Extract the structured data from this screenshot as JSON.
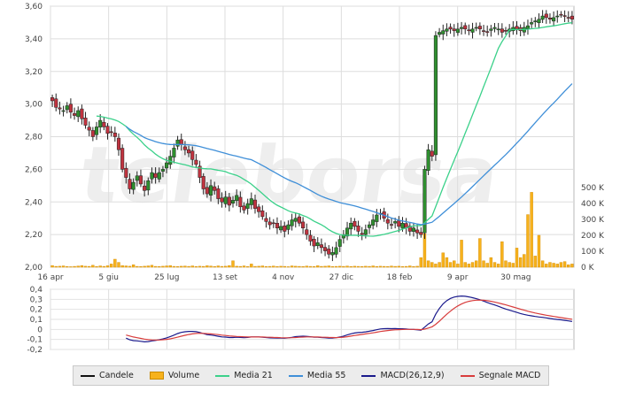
{
  "chart_data": {
    "type": "candlestick",
    "watermark": "teleborsa",
    "price_axis": {
      "ticks": [
        "3,60",
        "3,40",
        "3,20",
        "3,00",
        "2,80",
        "2,60",
        "2,40",
        "2,20",
        "2,00"
      ],
      "ylim": [
        2.0,
        3.6
      ]
    },
    "volume_axis": {
      "ticks": [
        "500 K",
        "400 K",
        "300 K",
        "200 K",
        "100 K",
        "0 K"
      ],
      "ylim": [
        0,
        500000
      ]
    },
    "macd_axis": {
      "ticks": [
        "0,4",
        "0,3",
        "0,2",
        "0,1",
        "0",
        "-0,1",
        "-0,2"
      ],
      "ylim": [
        -0.2,
        0.4
      ]
    },
    "date_labels": [
      "16 apr",
      "5 giu",
      "25 lug",
      "13 set",
      "4 nov",
      "27 dic",
      "18 feb",
      "9 apr",
      "30 mag"
    ],
    "close": [
      3.02,
      2.98,
      2.97,
      2.96,
      2.99,
      2.95,
      2.93,
      2.96,
      2.91,
      2.87,
      2.84,
      2.8,
      2.86,
      2.9,
      2.86,
      2.82,
      2.83,
      2.8,
      2.72,
      2.6,
      2.55,
      2.48,
      2.52,
      2.56,
      2.51,
      2.47,
      2.53,
      2.58,
      2.55,
      2.58,
      2.6,
      2.64,
      2.68,
      2.73,
      2.78,
      2.75,
      2.72,
      2.7,
      2.66,
      2.63,
      2.55,
      2.48,
      2.45,
      2.5,
      2.47,
      2.42,
      2.4,
      2.43,
      2.38,
      2.41,
      2.44,
      2.37,
      2.35,
      2.39,
      2.42,
      2.36,
      2.34,
      2.31,
      2.28,
      2.26,
      2.27,
      2.24,
      2.25,
      2.22,
      2.26,
      2.29,
      2.3,
      2.27,
      2.24,
      2.2,
      2.16,
      2.13,
      2.15,
      2.12,
      2.1,
      2.08,
      2.09,
      2.12,
      2.17,
      2.2,
      2.24,
      2.27,
      2.25,
      2.22,
      2.2,
      2.23,
      2.26,
      2.29,
      2.32,
      2.33,
      2.3,
      2.27,
      2.26,
      2.28,
      2.25,
      2.27,
      2.24,
      2.22,
      2.24,
      2.21,
      2.2,
      2.6,
      2.72,
      2.68,
      3.42,
      3.44,
      3.45,
      3.46,
      3.46,
      3.45,
      3.46,
      3.47,
      3.46,
      3.45,
      3.46,
      3.47,
      3.46,
      3.45,
      3.44,
      3.46,
      3.47,
      3.46,
      3.44,
      3.45,
      3.46,
      3.47,
      3.46,
      3.45,
      3.47,
      3.48,
      3.5,
      3.51,
      3.52,
      3.54,
      3.53,
      3.52,
      3.53,
      3.54,
      3.55,
      3.54,
      3.53,
      3.52
    ],
    "volume": [
      10,
      5,
      6,
      8,
      4,
      3,
      5,
      7,
      10,
      6,
      5,
      12,
      4,
      8,
      5,
      9,
      20,
      50,
      30,
      10,
      8,
      6,
      15,
      5,
      4,
      6,
      8,
      12,
      5,
      4,
      6,
      8,
      10,
      5,
      4,
      6,
      7,
      5,
      8,
      4,
      6,
      5,
      9,
      7,
      4,
      8,
      5,
      6,
      10,
      40,
      6,
      5,
      8,
      4,
      20,
      5,
      6,
      8,
      4,
      5,
      7,
      4,
      6,
      5,
      3,
      8,
      6,
      5,
      4,
      7,
      5,
      4,
      9,
      5,
      6,
      8,
      4,
      5,
      6,
      5,
      7,
      4,
      6,
      5,
      4,
      6,
      5,
      8,
      4,
      6,
      5,
      4,
      7,
      5,
      6,
      4,
      5,
      8,
      4,
      6,
      60,
      210,
      40,
      30,
      20,
      30,
      90,
      60,
      30,
      40,
      20,
      170,
      30,
      20,
      30,
      40,
      180,
      40,
      25,
      60,
      30,
      20,
      160,
      40,
      30,
      25,
      120,
      60,
      80,
      330,
      470,
      70,
      200,
      40,
      20,
      30,
      25,
      20,
      30,
      35,
      15,
      20
    ],
    "sma21_window": 21,
    "sma55_window": 55,
    "legend": [
      {
        "label": "Candele",
        "color": "#111111",
        "kind": "line"
      },
      {
        "label": "Volume",
        "color": "#f7b21c",
        "kind": "box"
      },
      {
        "label": "Media 21",
        "color": "#3bd18a",
        "kind": "line"
      },
      {
        "label": "Media 55",
        "color": "#3f8fd8",
        "kind": "line"
      },
      {
        "label": "MACD(26,12,9)",
        "color": "#1a1a8c",
        "kind": "line"
      },
      {
        "label": "Segnale MACD",
        "color": "#d83c3c",
        "kind": "line"
      }
    ]
  }
}
